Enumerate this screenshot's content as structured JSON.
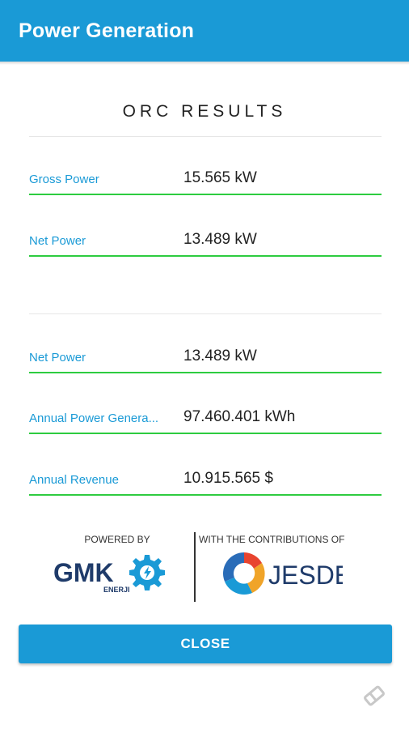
{
  "appbar": {
    "title": "Power Generation"
  },
  "section": {
    "title": "ORC RESULTS"
  },
  "results_top": [
    {
      "label": "Gross Power",
      "value": "15.565 kW"
    },
    {
      "label": "Net Power",
      "value": "13.489 kW"
    }
  ],
  "results_bottom": [
    {
      "label": "Net Power",
      "value": "13.489 kW"
    },
    {
      "label": "Annual Power Genera...",
      "value": "97.460.401 kWh"
    },
    {
      "label": "Annual Revenue",
      "value": "10.915.565 $"
    }
  ],
  "footer": {
    "powered_by": "POWERED BY",
    "powered_logo": "GMK ENERJI",
    "contributions": "WITH THE CONTRIBUTIONS OF",
    "contrib_logo": "JESDER"
  },
  "actions": {
    "close_label": "CLOSE"
  },
  "colors": {
    "accent": "#1a9ad6",
    "underline": "#2ecc40"
  }
}
